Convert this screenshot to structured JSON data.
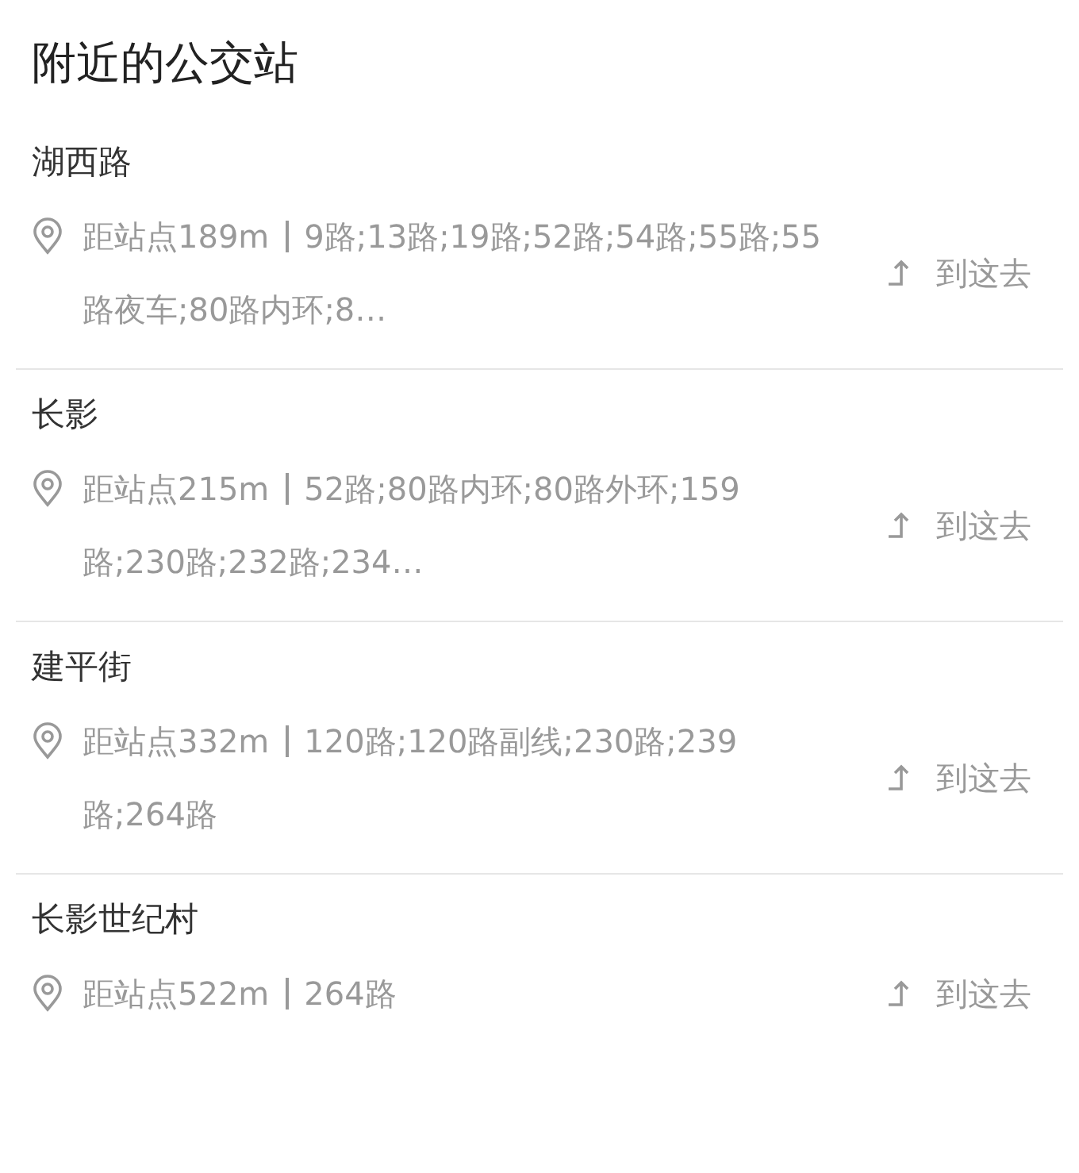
{
  "title": "附近的公交站",
  "stops": [
    {
      "name": "湖西路",
      "distance": "距站点189m",
      "routes": "9路;13路;19路;52路;54路;55路;55路夜车;80路内环;8…",
      "action": "到这去"
    },
    {
      "name": "长影",
      "distance": "距站点215m",
      "routes": "52路;80路内环;80路外环;159路;230路;232路;234…",
      "action": "到这去"
    },
    {
      "name": "建平街",
      "distance": "距站点332m",
      "routes": "120路;120路副线;230路;239路;264路",
      "action": "到这去"
    },
    {
      "name": "长影世纪村",
      "distance": "距站点522m",
      "routes": "264路",
      "action": "到这去"
    }
  ]
}
